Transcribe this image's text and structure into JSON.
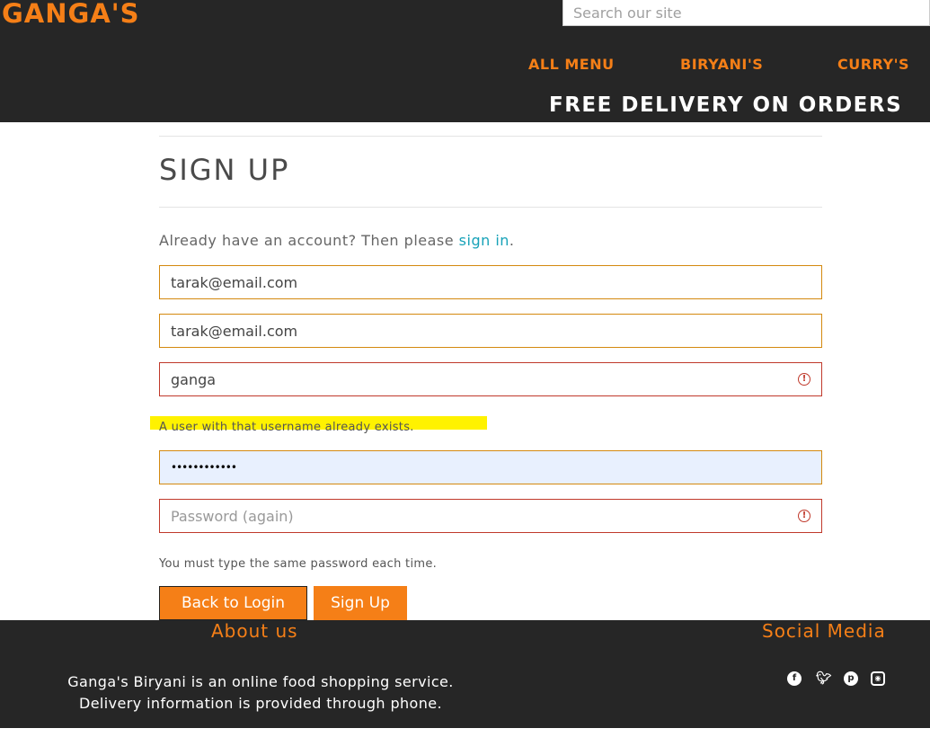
{
  "header": {
    "brand": "GANGA'S",
    "search_placeholder": "Search our site",
    "nav": [
      "ALL MENU",
      "BIRYANI'S",
      "CURRY'S"
    ],
    "promo": "FREE DELIVERY ON ORDERS"
  },
  "signup": {
    "title": "SIGN UP",
    "lead_text": "Already have an account? Then please ",
    "lead_link": "sign in",
    "lead_end": ".",
    "email_value": "tarak@email.com",
    "email_confirm_value": "tarak@email.com",
    "username_value": "ganga",
    "username_error": "A user with that username already exists.",
    "password_value": "••••••••••••",
    "password_again_placeholder": "Password (again)",
    "password_error": "You must type the same password each time.",
    "back_button": "Back to Login",
    "signup_button": "Sign Up",
    "error_icon": "!"
  },
  "footer": {
    "about_title": "About us",
    "social_title": "Social Media",
    "about_line1": "Ganga's Biryani is an online food shopping service.",
    "about_line2": "Delivery information is provided through phone.",
    "social_icons": [
      "facebook-icon",
      "twitter-icon",
      "pinterest-icon",
      "instagram-icon"
    ]
  },
  "colors": {
    "accent": "#f57f17",
    "dark": "#262626",
    "link": "#17a2b8",
    "error": "#c0392b",
    "highlight": "#fff200"
  }
}
